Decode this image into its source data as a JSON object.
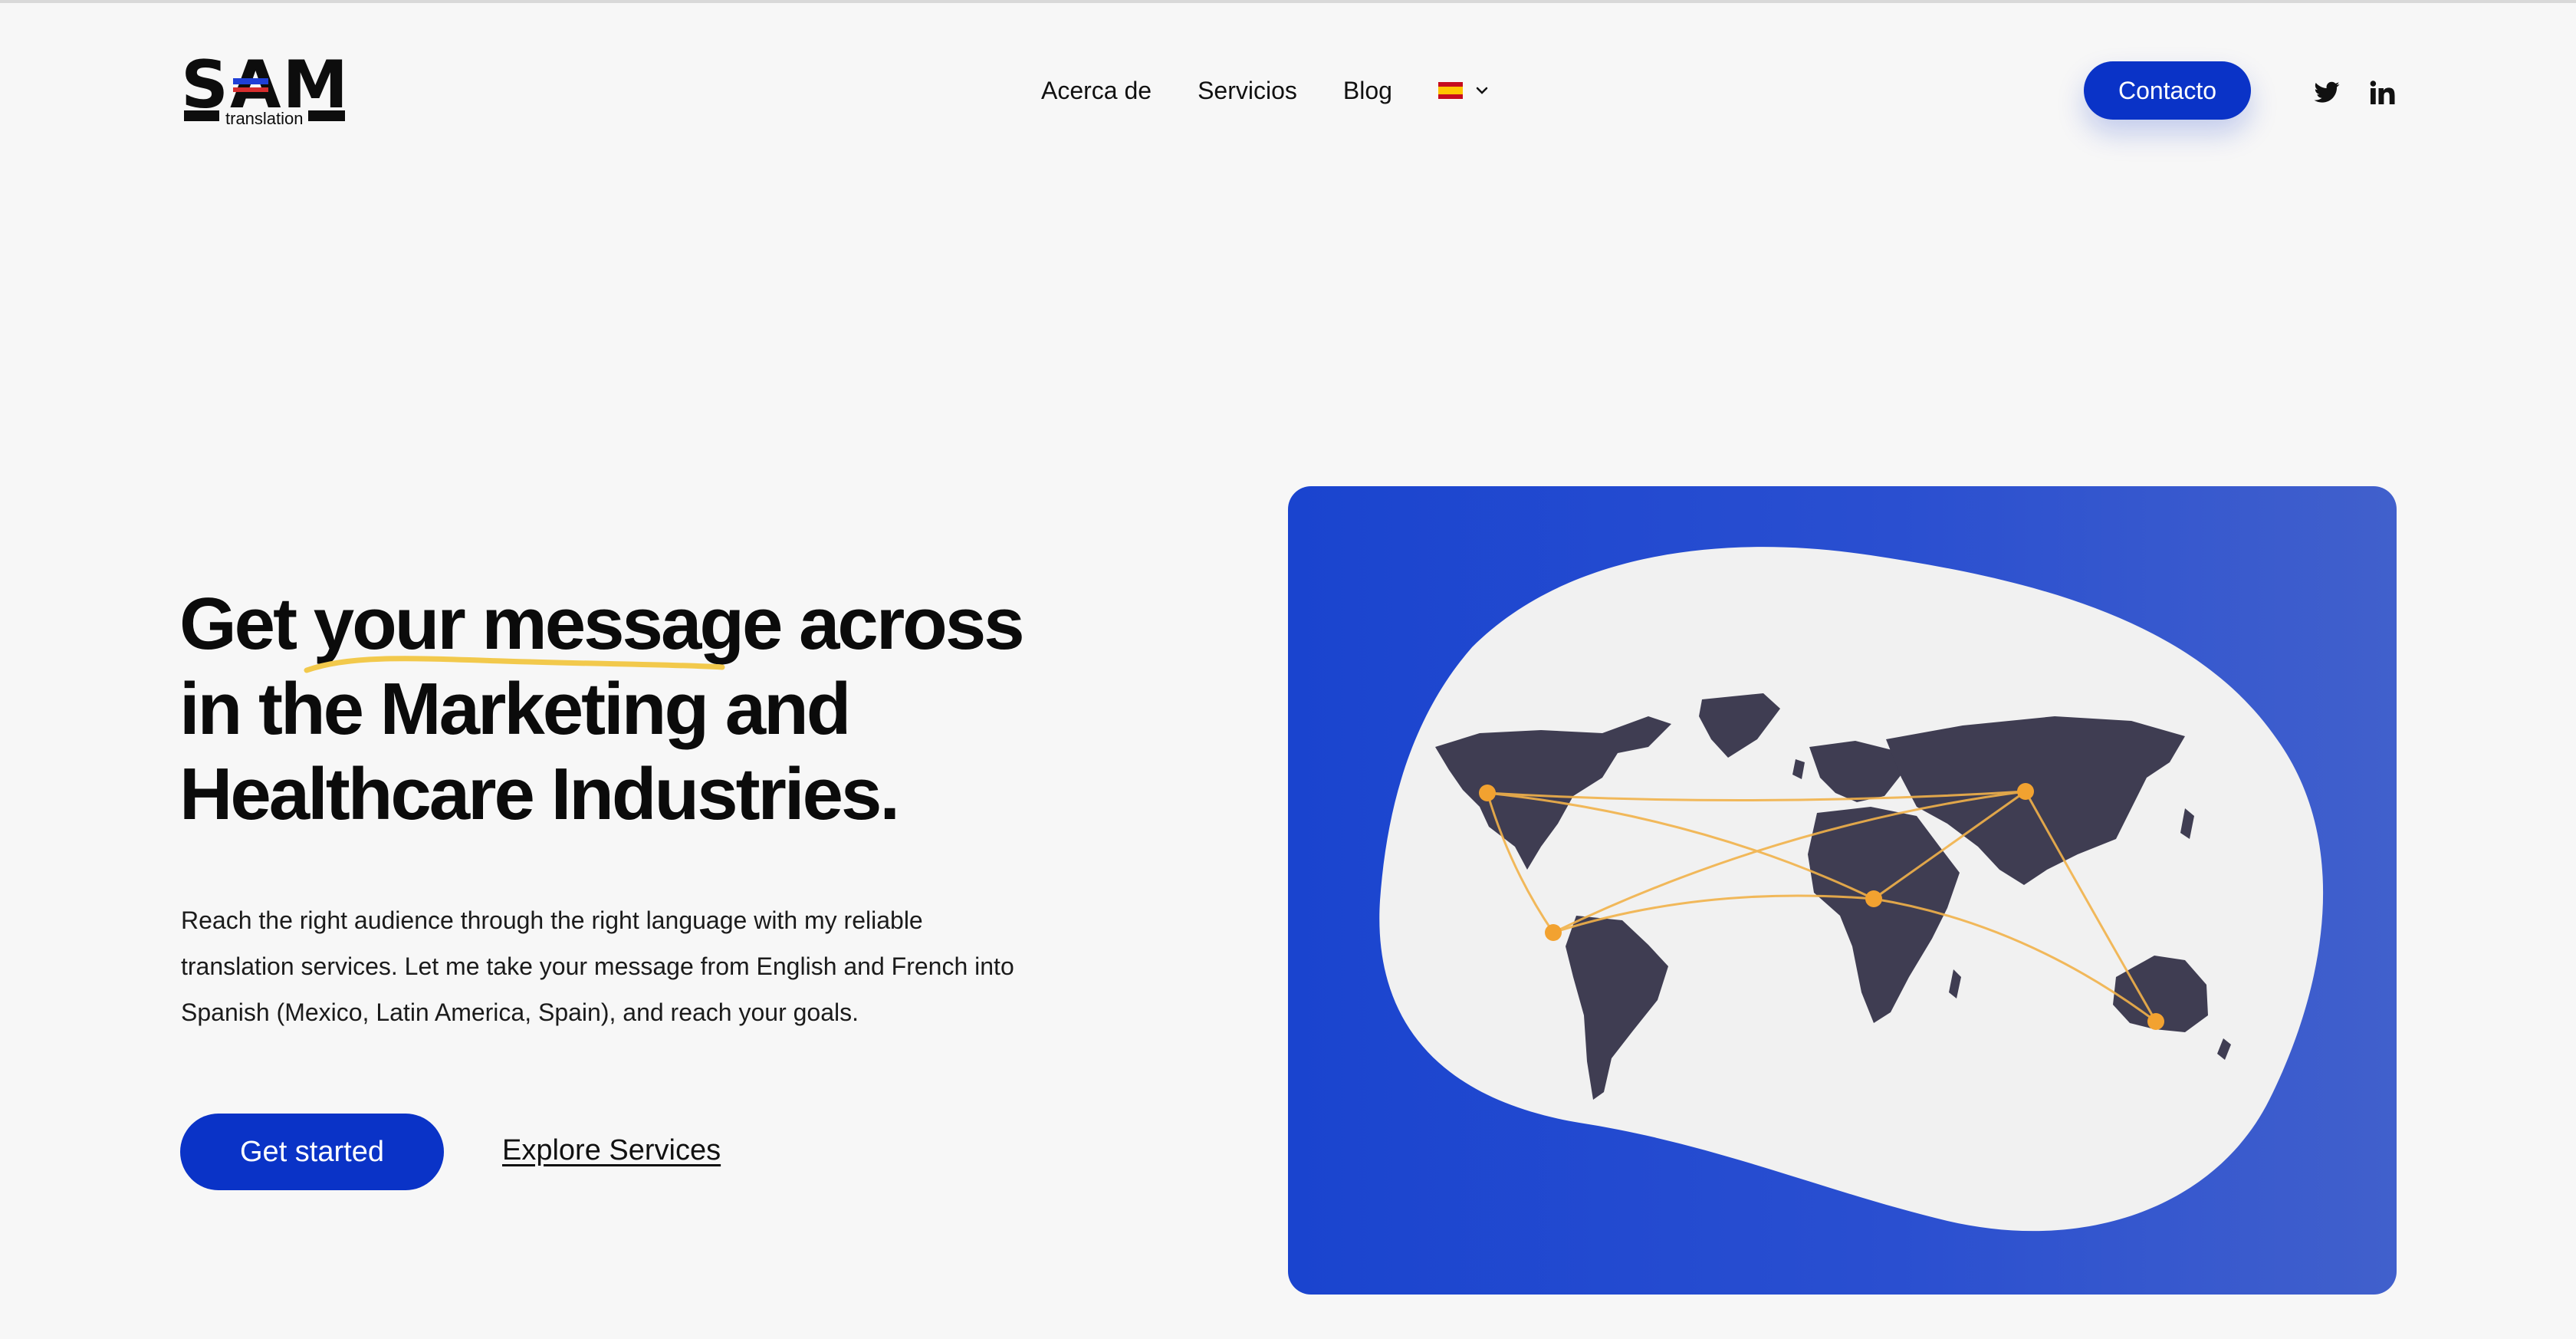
{
  "brand": {
    "logo_word": "SAM",
    "logo_sub": "translation",
    "accent": "#0a33c7",
    "text_color": "#0b0b0b",
    "background": "#f7f7f7"
  },
  "nav": {
    "items": [
      {
        "label": "Acerca de"
      },
      {
        "label": "Servicios"
      },
      {
        "label": "Blog"
      }
    ],
    "language_icon": "spain-flag-icon",
    "contact_label": "Contacto",
    "social_icons": [
      "twitter-icon",
      "linkedin-icon"
    ]
  },
  "hero": {
    "headline_lines": [
      "Get your message across",
      "in the Marketing and",
      "Healthcare Industries."
    ],
    "highlight": "your message",
    "highlight_color": "#f2c94c",
    "description": "Reach the right audience through the right language with my reliable translation services. Let me take your message from English and French into Spanish (Mexico, Latin America, Spain), and reach your goals.",
    "primary_cta": "Get started",
    "secondary_cta": "Explore Services"
  },
  "illustration": {
    "name": "world-map-illustration",
    "panel_color": "#1f46d0",
    "blob_color": "#f1f1f1",
    "continent_color": "#3f3d52",
    "node_color": "#f2a230",
    "route_color": "#f2b24a"
  }
}
